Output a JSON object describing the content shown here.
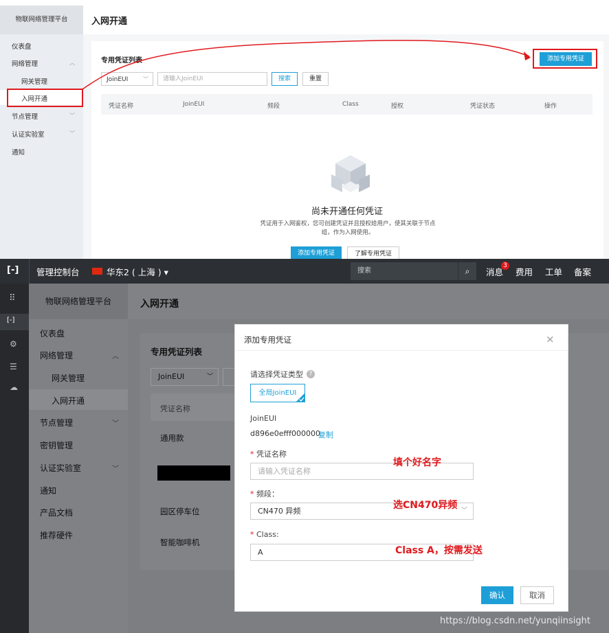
{
  "top": {
    "platform_title": "物联网络管理平台",
    "page_title": "入网开通",
    "sidebar": [
      {
        "label": "仪表盘",
        "chevron": ""
      },
      {
        "label": "网络管理",
        "chevron": "︿"
      },
      {
        "label": "网关管理",
        "chevron": ""
      },
      {
        "label": "入网开通",
        "chevron": ""
      },
      {
        "label": "节点管理",
        "chevron": "﹀"
      },
      {
        "label": "认证实验室",
        "chevron": "﹀"
      },
      {
        "label": "通知",
        "chevron": ""
      }
    ],
    "card_title": "专用凭证列表",
    "add_button": "添加专用凭证",
    "filter_select": "JoinEUI",
    "search_placeholder": "请输入JoinEUI",
    "search_button": "搜索",
    "reset_button": "重置",
    "columns": [
      "凭证名称",
      "JoinEUI",
      "频段",
      "Class",
      "授权",
      "凭证状态",
      "操作"
    ],
    "empty_title": "尚未开通任何凭证",
    "empty_desc_1": "凭证用于入网鉴权，您可创建凭证并且授权给用户，使其关联于节点",
    "empty_desc_2": "组，作为入网使用。",
    "empty_add_button": "添加专用凭证",
    "learn_button": "了解专用凭证"
  },
  "bottom": {
    "nav": {
      "console": "管理控制台",
      "region": "华东2 ( 上海 )",
      "search_placeholder": "搜索",
      "messages": "消息",
      "badge": "3",
      "fees": "费用",
      "tickets": "工单",
      "filing": "备案"
    },
    "platform_title": "物联网络管理平台",
    "page_title": "入网开通",
    "sidebar": [
      {
        "label": "仪表盘",
        "chevron": ""
      },
      {
        "label": "网络管理",
        "chevron": "︿"
      },
      {
        "label": "网关管理",
        "chevron": ""
      },
      {
        "label": "入网开通",
        "chevron": ""
      },
      {
        "label": "节点管理",
        "chevron": "﹀"
      },
      {
        "label": "密钥管理",
        "chevron": ""
      },
      {
        "label": "认证实验室",
        "chevron": "﹀"
      },
      {
        "label": "通知",
        "chevron": ""
      },
      {
        "label": "产品文档",
        "chevron": ""
      },
      {
        "label": "推荐硬件",
        "chevron": ""
      }
    ],
    "card_title": "专用凭证列表",
    "filter_select": "JoinEUI",
    "col_name": "凭证名称",
    "rows": [
      "通用款",
      "",
      "园区停车位",
      "智能咖啡机"
    ],
    "modal": {
      "title": "添加专用凭证",
      "type_label": "请选择凭证类型",
      "type_option": "全局JoinEUI",
      "joineui_label": "JoinEUI",
      "joineui_value": "d896e0efff000000",
      "copy_link": "复制",
      "name_label": "凭证名称",
      "name_placeholder": "请输入凭证名称",
      "band_label": "频段：",
      "band_value": "CN470 异频",
      "class_label": "Class:",
      "class_value": "A",
      "confirm": "确认",
      "cancel": "取消"
    },
    "annotations": {
      "name_note": "填个好名字",
      "band_note": "选CN470异频",
      "class_note": "Class A，按需发送"
    },
    "watermark": "https://blog.csdn.net/yunqiinsight"
  },
  "colors": {
    "accent": "#1e9fd7",
    "annotation_red": "#e0191d",
    "dark_nav": "#2c3035"
  }
}
